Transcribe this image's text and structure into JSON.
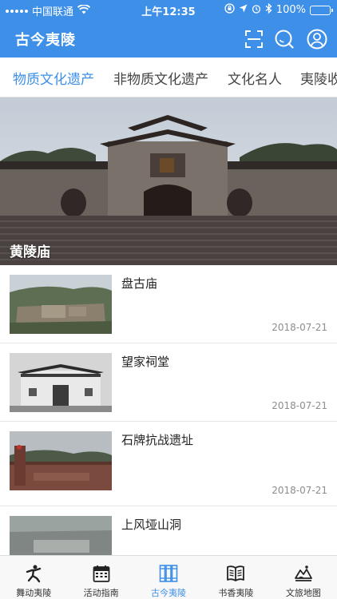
{
  "status_bar": {
    "carrier": "中国联通",
    "time": "上午12:35",
    "battery_percent": "100%",
    "battery_level": 1.0
  },
  "header": {
    "title": "古今夷陵",
    "icons": [
      "scan-icon",
      "chat-search-icon",
      "user-icon"
    ]
  },
  "tabs": [
    {
      "label": "物质文化遗产",
      "active": true
    },
    {
      "label": "非物质文化遗产",
      "active": false
    },
    {
      "label": "文化名人",
      "active": false
    },
    {
      "label": "夷陵收",
      "active": false
    }
  ],
  "hero": {
    "caption": "黄陵庙"
  },
  "list": [
    {
      "title": "盘古庙",
      "date": "2018-07-21"
    },
    {
      "title": "望家祠堂",
      "date": "2018-07-21"
    },
    {
      "title": "石牌抗战遗址",
      "date": "2018-07-21"
    },
    {
      "title": "上风垭山洞",
      "date": ""
    }
  ],
  "tabbar": [
    {
      "label": "舞动夷陵",
      "icon": "dancer-icon",
      "active": false
    },
    {
      "label": "活动指南",
      "icon": "calendar-icon",
      "active": false
    },
    {
      "label": "古今夷陵",
      "icon": "books-icon",
      "active": true
    },
    {
      "label": "书香夷陵",
      "icon": "book-open-icon",
      "active": false
    },
    {
      "label": "文旅地图",
      "icon": "map-icon",
      "active": false
    }
  ],
  "colors": {
    "accent": "#3d8fe8",
    "text": "#222222",
    "muted": "#8d8d8d"
  }
}
